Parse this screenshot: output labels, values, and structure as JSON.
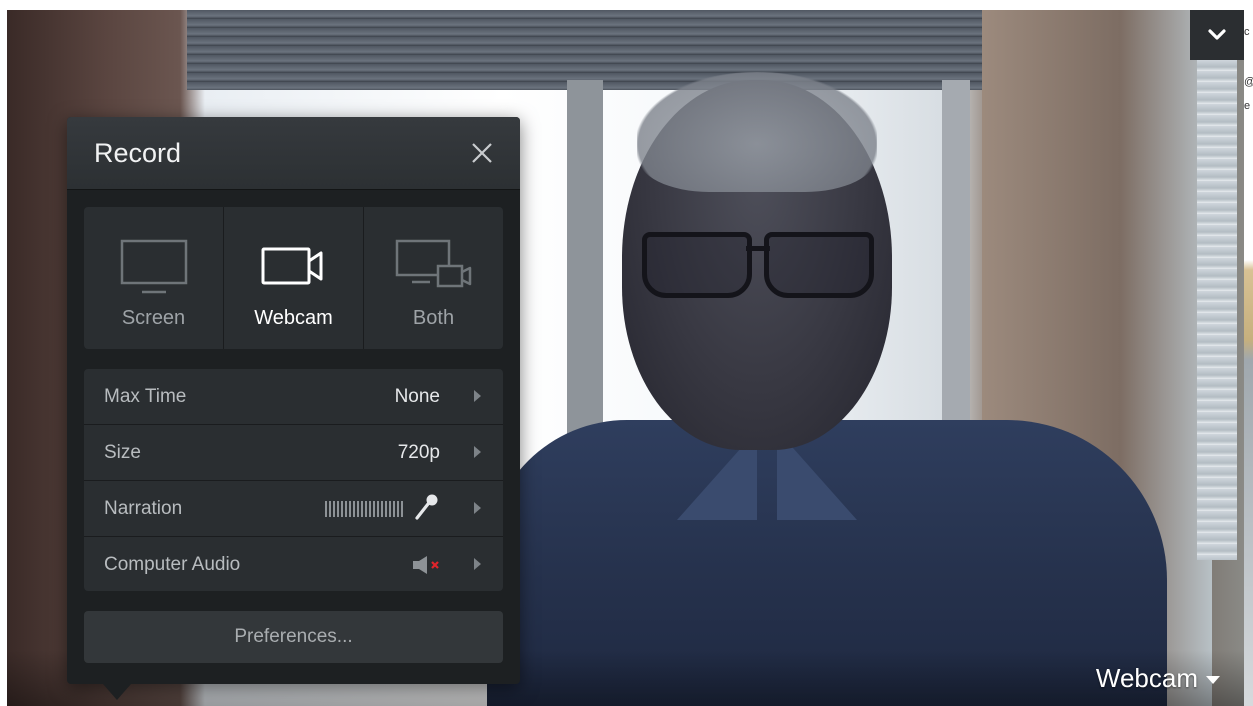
{
  "panel": {
    "title": "Record",
    "modes": [
      {
        "label": "Screen",
        "icon": "monitor-icon",
        "active": false
      },
      {
        "label": "Webcam",
        "icon": "video-camera-icon",
        "active": true
      },
      {
        "label": "Both",
        "icon": "monitor-camera-icon",
        "active": false
      }
    ],
    "settings": [
      {
        "label": "Max Time",
        "value": "None"
      },
      {
        "label": "Size",
        "value": "720p"
      },
      {
        "label": "Narration",
        "value": "",
        "icon": "microphone-icon",
        "level": "meter"
      },
      {
        "label": "Computer Audio",
        "value": "",
        "icon": "speaker-muted-icon"
      }
    ],
    "preferences_label": "Preferences..."
  },
  "preview": {
    "source_label": "Webcam"
  },
  "edge_text": [
    "c",
    "@",
    "e"
  ],
  "colors": {
    "panel_bg": "#1d2022",
    "mute_x": "#e0242b"
  }
}
